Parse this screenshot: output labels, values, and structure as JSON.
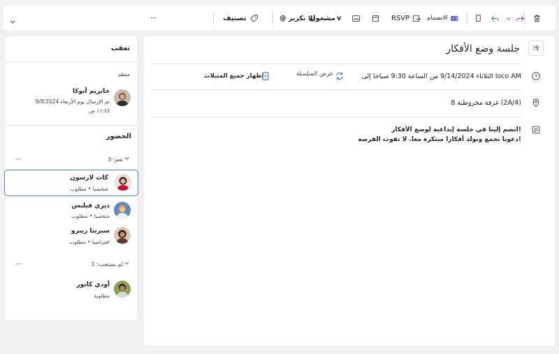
{
  "toolbar": {
    "categorize_label": "تصنيف",
    "no_reminder_label": "@ بلا تكرير",
    "busy_label": "مشغول",
    "busy_chevron": "v",
    "join_label": "الانضمام",
    "rsvp_label": "RSVP",
    "more_glyph": "···",
    "expand_glyph": "⌄"
  },
  "event": {
    "title": "جلسة وضع الأفكار",
    "datetime": "الثلاثاء 9/14/2024 من الساعة 9:30 صباحا إلى loco AM",
    "series_label": "عرض السلسلة",
    "show_similar_label": "إظهار جميع المثيلات",
    "location": "غرفة مخروطية 8 (2A/4)",
    "description_line1": "انضم إلينا في جلسة إبداعية لوضع الأفكار!",
    "description_line2": "دعونا نجمع ونولد أفكارا مبتكرة معا. لا تفوت الفرصة!"
  },
  "tracking": {
    "title": "تعقب",
    "organizer_label": "منظم",
    "organizer": {
      "name": "خاتريم أنوكا",
      "sent_line": "تم الإرسال يوم الأربعاء 9/8/2024",
      "time": "١١:٤٥ ص"
    },
    "attendance_label": "الحضور",
    "yes_group": "نعم: 3",
    "no_response_group": "لم يستجب: 1",
    "attendees": [
      {
        "name": "كات لارسون",
        "status": "شخصيا • مطلوب"
      },
      {
        "name": "ديزي فيلبس",
        "status": "شخصيا • مطلوب"
      },
      {
        "name": "سيرينا ريبرو",
        "status": "افتراضيا • مطلوب"
      }
    ],
    "no_response_attendees": [
      {
        "name": "أودي كابور",
        "status": "مطلوبة"
      }
    ],
    "group_more": "···"
  }
}
